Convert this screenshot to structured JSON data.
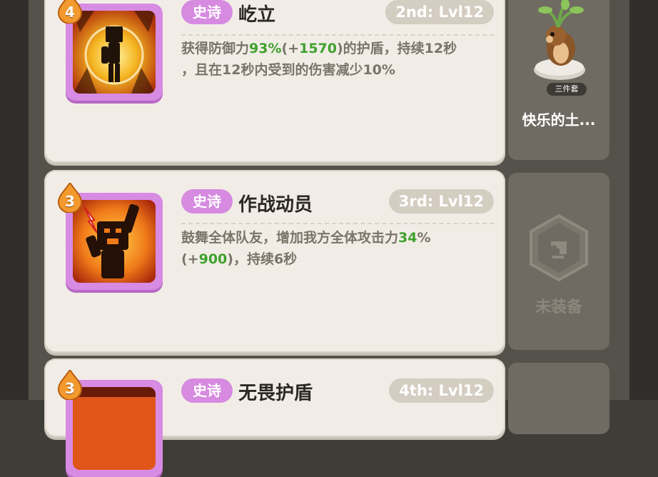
{
  "skills": [
    {
      "rank": "4",
      "rarity": "史诗",
      "name": "屹立",
      "level": "2nd: Lvl12",
      "desc_parts": [
        "获得防御力",
        "93%",
        "(+",
        "1570",
        ")的护盾，持续12秒",
        "，且在12秒内受到的伤害减少10%"
      ],
      "icon": "shield-hero-icon"
    },
    {
      "rank": "3",
      "rarity": "史诗",
      "name": "作战动员",
      "level": "3rd: Lvl12",
      "desc_parts": [
        "鼓舞全体队友，增加我方全体攻击力",
        "34",
        "%",
        "(+",
        "900",
        ")，持续6秒"
      ],
      "icon": "rally-cheer-icon"
    },
    {
      "rank": "3",
      "rarity": "史诗",
      "name": "无畏护盾",
      "level": "4th: Lvl12",
      "icon": "fearless-shield-icon"
    }
  ],
  "equipment": {
    "slot1": {
      "tag": "三件套",
      "name": "快乐的土...",
      "icon": "happy-groundhog-icon"
    },
    "slot2": {
      "status": "未装备",
      "icon": "empty-slot-icon"
    }
  },
  "colors": {
    "rarity_epic": "#d68ae0",
    "highlight_green": "#3fa12e",
    "card_bg": "#f1ede6"
  }
}
